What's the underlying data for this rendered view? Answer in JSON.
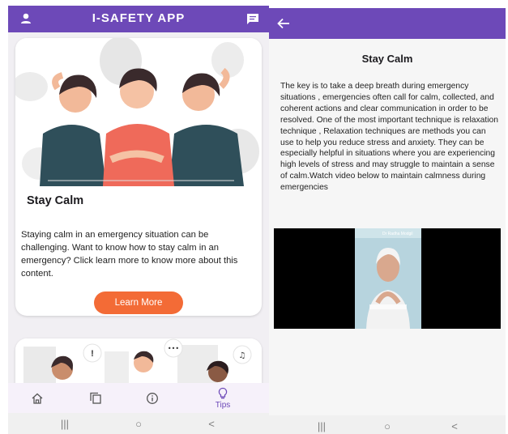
{
  "left_screen": {
    "app_title": "I-SAFETY APP",
    "card1": {
      "title": "Stay Calm",
      "body": "Staying calm in an emergency situation can be challenging. Want to know how to stay calm in an emergency? Click learn more to know more about this content.",
      "button_label": "Learn More"
    },
    "card2": {
      "bubble_labels": [
        "!",
        "•••",
        "♫"
      ]
    },
    "bottom_nav": [
      {
        "icon": "home-icon",
        "label": ""
      },
      {
        "icon": "library-icon",
        "label": ""
      },
      {
        "icon": "info-icon",
        "label": ""
      },
      {
        "icon": "lightbulb-icon",
        "label": "Tips",
        "selected": true
      }
    ]
  },
  "right_screen": {
    "title": "Stay Calm",
    "body": "The key is to take a deep breath during emergency situations , emergencies often call for calm, collected, and coherent actions and clear communication in order to be resolved. One of the most important technique is relaxation technique , Relaxation techniques are methods you can use to help you reduce stress and anxiety. They can be especially helpful in situations where you are experiencing high levels of stress and may struggle to maintain a sense of calm.Watch video below to maintain calmness during emergencies",
    "video": {
      "caption": "Dr Radha Modgil"
    }
  },
  "system_nav": {
    "recent_glyph": "|||",
    "home_glyph": "○",
    "back_glyph": "<"
  },
  "colors": {
    "primary": "#6d49b8",
    "accent": "#f36b36",
    "background": "#f1eff3"
  }
}
